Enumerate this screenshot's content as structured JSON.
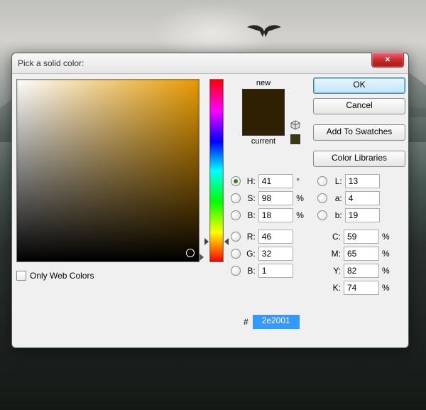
{
  "window": {
    "title": "Pick a solid color:",
    "close_icon": "✕"
  },
  "preview": {
    "new_label": "new",
    "current_label": "current",
    "new_color": "#2e2001",
    "current_color": "#2e2001"
  },
  "buttons": {
    "ok": "OK",
    "cancel": "Cancel",
    "add_swatches": "Add To Swatches",
    "color_libraries": "Color Libraries"
  },
  "hsb": {
    "h": {
      "label": "H:",
      "value": "41",
      "unit": "°"
    },
    "s": {
      "label": "S:",
      "value": "98",
      "unit": "%"
    },
    "b": {
      "label": "B:",
      "value": "18",
      "unit": "%"
    }
  },
  "rgb": {
    "r": {
      "label": "R:",
      "value": "46"
    },
    "g": {
      "label": "G:",
      "value": "32"
    },
    "b": {
      "label": "B:",
      "value": "1"
    }
  },
  "lab": {
    "l": {
      "label": "L:",
      "value": "13"
    },
    "a": {
      "label": "a:",
      "value": "4"
    },
    "b": {
      "label": "b:",
      "value": "19"
    }
  },
  "cmyk": {
    "c": {
      "label": "C:",
      "value": "59",
      "unit": "%"
    },
    "m": {
      "label": "M:",
      "value": "65",
      "unit": "%"
    },
    "y": {
      "label": "Y:",
      "value": "82",
      "unit": "%"
    },
    "k": {
      "label": "K:",
      "value": "74",
      "unit": "%"
    }
  },
  "hex": {
    "hash": "#",
    "value": "2e2001"
  },
  "only_web": {
    "label": "Only Web Colors"
  }
}
